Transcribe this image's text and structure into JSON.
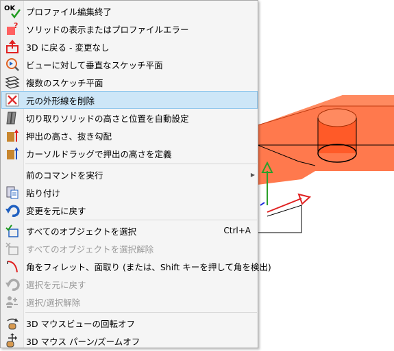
{
  "colors": {
    "highlight": "#cde6f7",
    "part_fill": "#ff6a3a",
    "menu_bg": "#f5f5f5",
    "disabled_text": "#9a9a9a"
  },
  "menu": {
    "items": [
      {
        "label": "プロファイル編集終了",
        "icon": "ok-check-icon",
        "icon_text": "OK"
      },
      {
        "label": "ソリッドの表示またはプロファイルエラー",
        "icon": "error-question-icon"
      },
      {
        "label": "3D に戻る - 変更なし",
        "icon": "return-3d-icon"
      },
      {
        "label": "ビューに対して垂直なスケッチ平面",
        "icon": "view-normal-icon"
      },
      {
        "label": "複数のスケッチ平面",
        "icon": "multiple-planes-icon"
      },
      {
        "label": "元の外形線を削除",
        "icon": "delete-outline-icon"
      },
      {
        "label": "切り取りソリッドの高さと位置を自動設定",
        "icon": "auto-cut-icon"
      },
      {
        "label": "押出の高さ、抜き勾配",
        "icon": "extrude-height-icon"
      },
      {
        "label": "カーソルドラッグで押出の高さを定義",
        "icon": "drag-extrude-icon"
      },
      {
        "label": "前のコマンドを実行",
        "icon": ""
      },
      {
        "label": "貼り付け",
        "icon": "paste-icon"
      },
      {
        "label": "変更を元に戻す",
        "icon": "undo-icon"
      },
      {
        "label": "すべてのオブジェクトを選択",
        "icon": "select-all-icon",
        "shortcut": "Ctrl+A"
      },
      {
        "label": "すべてのオブジェクトを選択解除",
        "icon": "deselect-all-icon"
      },
      {
        "label": "角をフィレット、面取り (または、Shift キーを押して角を検出)",
        "icon": "fillet-icon"
      },
      {
        "label": "選択を元に戻す",
        "icon": "undo-selection-icon"
      },
      {
        "label": "選択/選択解除",
        "icon": "select-toggle-icon"
      },
      {
        "label": "3D マウスビューの回転オフ",
        "icon": "mouse-rotate-icon"
      },
      {
        "label": "3D マウス パーン/ズームオフ",
        "icon": "mouse-pan-icon"
      }
    ]
  }
}
